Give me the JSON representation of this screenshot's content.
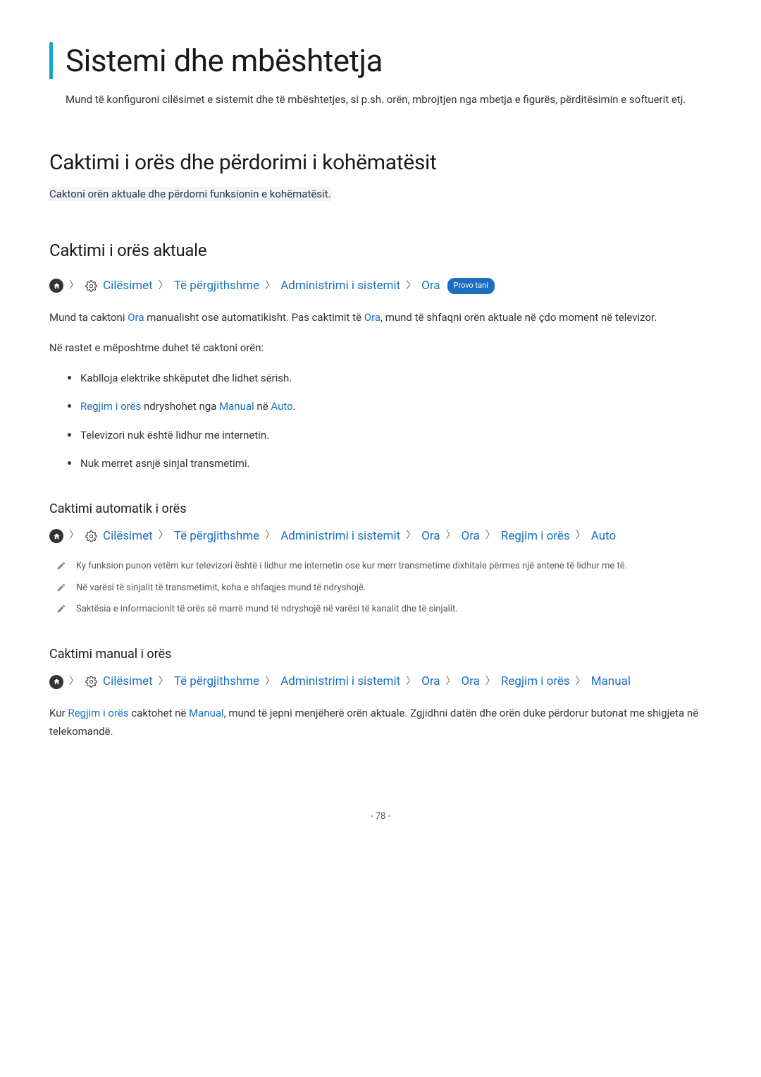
{
  "title": "Sistemi dhe mbështetja",
  "intro": "Mund të konfiguroni cilësimet e sistemit dhe të mbështetjes, si p.sh. orën, mbrojtjen nga mbetja e figurës, përditësimin e softuerit etj.",
  "section1": {
    "heading": "Caktimi i orës dhe përdorimi i kohëmatësit",
    "subtitle": "Caktoni orën aktuale dhe përdorni funksionin e kohëmatësit."
  },
  "section2": {
    "heading": "Caktimi i orës aktuale",
    "breadcrumb": [
      "Cilësimet",
      "Të përgjithshme",
      "Administrimi i sistemit",
      "Ora"
    ],
    "badge": "Provo tani",
    "para1_a": "Mund ta caktoni ",
    "para1_link1": "Ora",
    "para1_b": " manualisht ose automatikisht. Pas caktimit të ",
    "para1_link2": "Ora",
    "para1_c": ", mund të shfaqni orën aktuale në çdo moment në televizor.",
    "para2": "Në rastet e mëposhtme duhet të caktoni orën:",
    "bullets": [
      {
        "text": "Kablloja elektrike shkëputet dhe lidhet sërish."
      },
      {
        "link1": "Regjim i orës",
        "mid1": " ndryshohet nga ",
        "link2": "Manual",
        "mid2": " në ",
        "link3": "Auto",
        "end": "."
      },
      {
        "text": "Televizori nuk është lidhur me internetin."
      },
      {
        "text": "Nuk merret asnjë sinjal transmetimi."
      }
    ]
  },
  "section3": {
    "heading": "Caktimi automatik i orës",
    "breadcrumb": [
      "Cilësimet",
      "Të përgjithshme",
      "Administrimi i sistemit",
      "Ora",
      "Ora",
      "Regjim i orës",
      "Auto"
    ],
    "notes": [
      "Ky funksion punon vetëm kur televizori është i lidhur me internetin ose kur merr transmetime dixhitale përmes një antene të lidhur me të.",
      "Në varësi të sinjalit të transmetimit, koha e shfaqjes mund të ndryshojë.",
      "Saktësia e informacionit të orës së marrë mund të ndryshojë në varësi të kanalit dhe të sinjalit."
    ]
  },
  "section4": {
    "heading": "Caktimi manual i orës",
    "breadcrumb": [
      "Cilësimet",
      "Të përgjithshme",
      "Administrimi i sistemit",
      "Ora",
      "Ora",
      "Regjim i orës",
      "Manual"
    ],
    "para_a": "Kur ",
    "para_link1": "Regjim i orës",
    "para_b": " caktohet në ",
    "para_link2": "Manual",
    "para_c": ", mund të jepni menjëherë orën aktuale. Zgjidhni datën dhe orën duke përdorur butonat me shigjeta në telekomandë."
  },
  "page_number": "- 78 -"
}
